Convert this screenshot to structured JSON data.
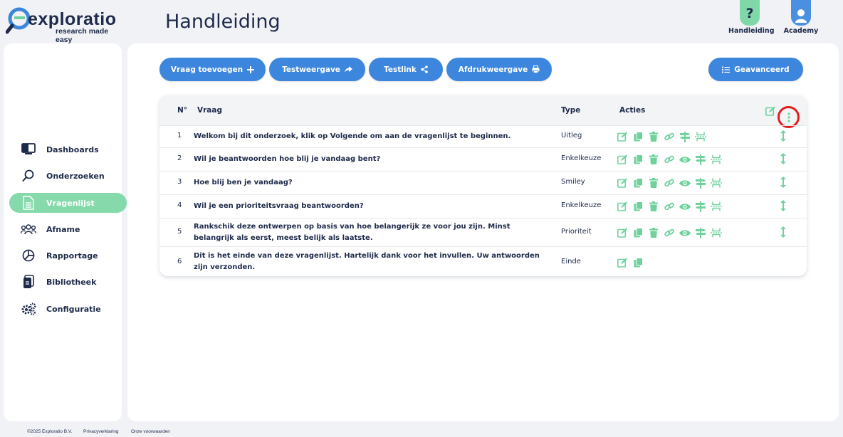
{
  "logo": {
    "wordmark": "exploratio",
    "tagline": "research made easy"
  },
  "page_title": "Handleiding",
  "top_buttons": {
    "help_label": "Handleiding",
    "help_glyph": "?",
    "academy_label": "Academy"
  },
  "sidebar": {
    "items": [
      {
        "label": "Dashboards",
        "icon": "dashboard-icon"
      },
      {
        "label": "Onderzoeken",
        "icon": "search-icon"
      },
      {
        "label": "Vragenlijst",
        "icon": "document-icon",
        "active": true
      },
      {
        "label": "Afname",
        "icon": "people-icon"
      },
      {
        "label": "Rapportage",
        "icon": "pie-chart-icon"
      },
      {
        "label": "Bibliotheek",
        "icon": "library-icon"
      },
      {
        "label": "Configuratie",
        "icon": "gears-icon"
      }
    ]
  },
  "toolbar": {
    "add_label": "Vraag toevoegen",
    "test_view_label": "Testweergave",
    "test_link_label": "Testlink",
    "print_label": "Afdrukweergave",
    "advanced_label": "Geavanceerd"
  },
  "table": {
    "headers": {
      "num": "N°",
      "question": "Vraag",
      "type": "Type",
      "actions": "Acties"
    },
    "rows": [
      {
        "num": "1",
        "question": "Welkom bij dit onderzoek, klik op Volgende om aan de vragenlijst te beginnen.",
        "type": "Uitleg"
      },
      {
        "num": "2",
        "question": "Wil je beantwoorden hoe blij je vandaag bent?",
        "type": "Enkelkeuze"
      },
      {
        "num": "3",
        "question": "Hoe blij ben je vandaag?",
        "type": "Smiley"
      },
      {
        "num": "4",
        "question": "Wil je een prioriteitsvraag beantwoorden?",
        "type": "Enkelkeuze"
      },
      {
        "num": "5",
        "question": "Rankschik deze ontwerpen op basis van hoe belangerijk ze voor jou zijn. Minst belangrijk als eerst, meest belijk als laatste.",
        "type": "Prioriteit"
      },
      {
        "num": "6",
        "question": "Dit is het einde van deze vragenlijst. Hartelijk dank voor het invullen. Uw antwoorden zijn verzonden.",
        "type": "Einde"
      }
    ]
  },
  "footer": {
    "copyright": "©2025 Exploratio B.V.",
    "privacy": "Privacyverklaring",
    "terms": "Onze voorwaarden"
  },
  "colors": {
    "primary": "#3d86dd",
    "accent": "#6fd29c",
    "navy": "#1e2a4a",
    "highlight": "#e01e1e"
  }
}
